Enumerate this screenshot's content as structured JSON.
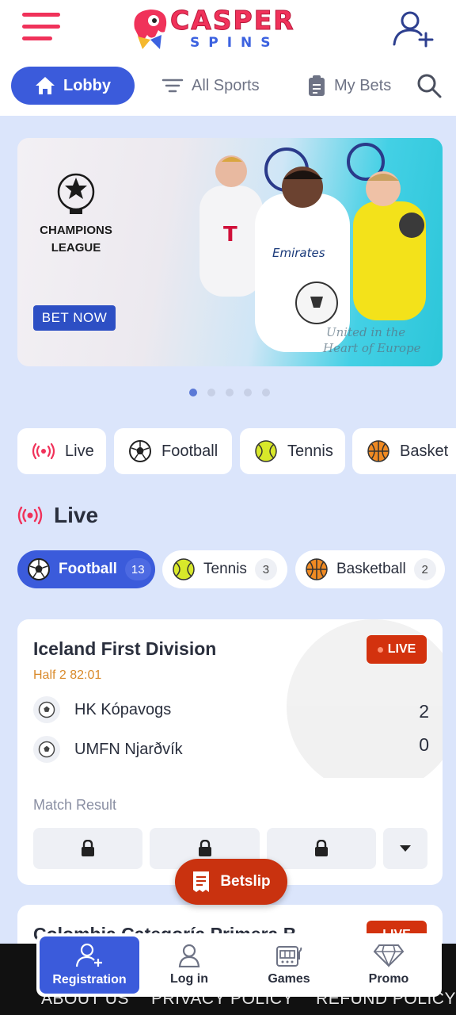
{
  "brand": {
    "top": "CASPER",
    "bottom": "SPINS",
    "accent": "#f0325a",
    "primary": "#3b5bdb"
  },
  "header": {
    "menu_icon": "hamburger-icon",
    "account_icon": "add-user-icon"
  },
  "nav": {
    "lobby": "Lobby",
    "all_sports": "All Sports",
    "my_bets": "My Bets",
    "search_icon": "search-icon"
  },
  "banner": {
    "competition_line1": "CHAMPIONS",
    "competition_line2": "LEAGUE",
    "cta": "BET NOW",
    "tagline": "United in the Heart of Europe",
    "slides_total": 5,
    "active_slide": 1
  },
  "sport_chips": [
    {
      "label": "Live",
      "icon": "live-icon"
    },
    {
      "label": "Football",
      "icon": "football-icon"
    },
    {
      "label": "Tennis",
      "icon": "tennis-icon"
    },
    {
      "label": "Basket",
      "icon": "basketball-icon"
    }
  ],
  "live": {
    "title": "Live",
    "filters": [
      {
        "label": "Football",
        "count": "13",
        "icon": "football-icon",
        "active": true
      },
      {
        "label": "Tennis",
        "count": "3",
        "icon": "tennis-icon",
        "active": false
      },
      {
        "label": "Basketball",
        "count": "2",
        "icon": "basketball-icon",
        "active": false
      }
    ]
  },
  "match": {
    "league": "Iceland First Division",
    "time": "Half 2 82:01",
    "badge": "LIVE",
    "home_team": "HK Kópavogs",
    "away_team": "UMFN Njarðvík",
    "home_score": "2",
    "away_score": "0",
    "market": "Match Result",
    "odds_locked": true
  },
  "match2": {
    "league": "Colombia Categoría Primera B",
    "badge": "LIVE"
  },
  "betslip": {
    "label": "Betslip"
  },
  "footer": {
    "links": [
      "ABOUT US",
      "PRIVACY POLICY",
      "REFUND POLICY"
    ]
  },
  "tabbar": [
    {
      "label": "Registration",
      "icon": "add-user-icon",
      "active": true
    },
    {
      "label": "Log in",
      "icon": "user-icon",
      "active": false
    },
    {
      "label": "Games",
      "icon": "slot-machine-icon",
      "active": false
    },
    {
      "label": "Promo",
      "icon": "diamond-icon",
      "active": false
    }
  ]
}
